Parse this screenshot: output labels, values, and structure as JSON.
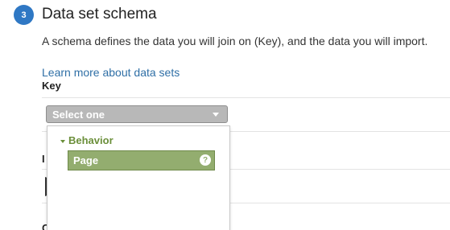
{
  "section": {
    "step_number": "3",
    "title": "Data set schema",
    "description": "A schema defines the data you will join on (Key), and the data you will import.",
    "learn_more_link": "Learn more about data sets"
  },
  "key": {
    "label": "Key",
    "select": {
      "selected_value": "Select one"
    }
  },
  "dropdown": {
    "groups": [
      {
        "label": "Behavior",
        "options": [
          {
            "label": "Page",
            "selected": true,
            "help_icon": "help-icon"
          }
        ]
      }
    ]
  },
  "background_fields": {
    "partial_label_1": "I",
    "partial_label_2": "C"
  },
  "colors": {
    "step_badge": "#2f78c4",
    "link": "#2f6fa6",
    "select_bg": "#b8b8b8",
    "group_header": "#6b8f3a",
    "option_selected_bg": "#93ad6f"
  }
}
